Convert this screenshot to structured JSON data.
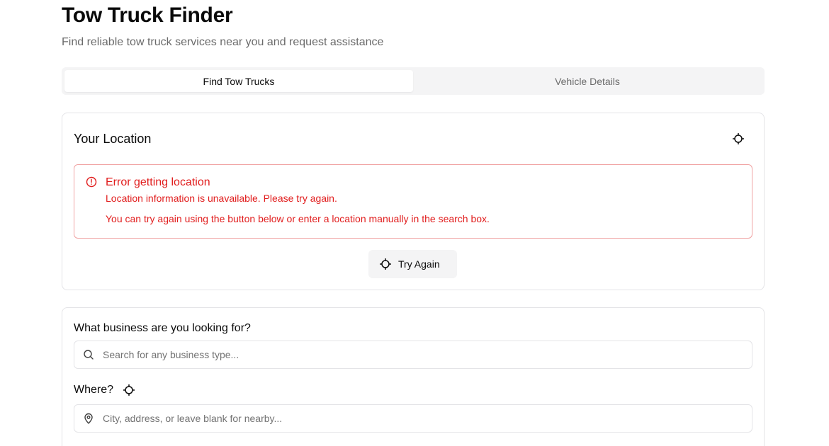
{
  "header": {
    "title": "Tow Truck Finder",
    "subtitle": "Find reliable tow truck services near you and request assistance"
  },
  "tabs": [
    {
      "label": "Find Tow Trucks",
      "active": true
    },
    {
      "label": "Vehicle Details",
      "active": false
    }
  ],
  "location_card": {
    "title": "Your Location",
    "locate_icon": "crosshair-icon",
    "error": {
      "icon": "alert-circle-icon",
      "title": "Error getting location",
      "description": "Location information is unavailable. Please try again.",
      "hint": "You can try again using the button below or enter a location manually in the search box."
    },
    "retry_button": {
      "icon": "crosshair-icon",
      "label": "Try Again"
    }
  },
  "search_card": {
    "business_label": "What business are you looking for?",
    "business_placeholder": "Search for any business type...",
    "business_value": "",
    "where_label": "Where?",
    "where_placeholder": "City, address, or leave blank for nearby...",
    "where_value": ""
  },
  "colors": {
    "error": "#e11d1d",
    "error_border": "#f0a3a3",
    "muted": "#6b6b6b",
    "tab_bg": "#f4f4f5",
    "border": "#e4e4e7"
  }
}
